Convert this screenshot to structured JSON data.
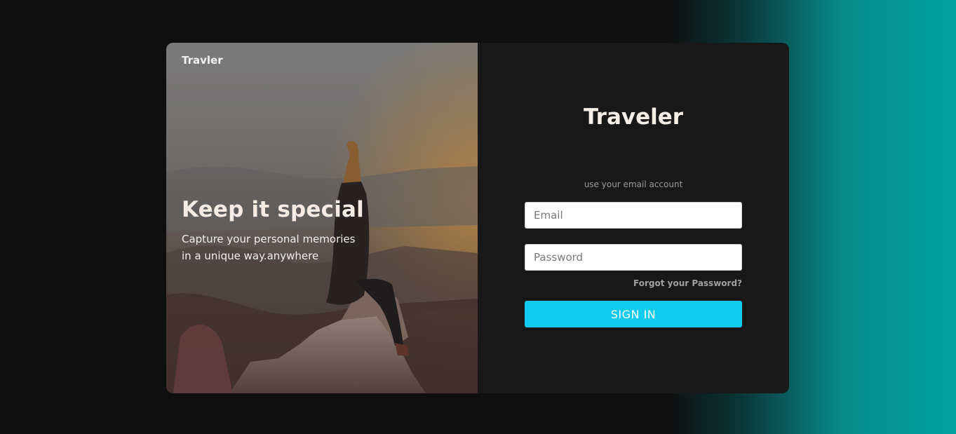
{
  "hero": {
    "brand": "Travler",
    "title": "Keep it special",
    "subtitle_line1": "Capture your personal memories",
    "subtitle_line2": "in a unique way.anywhere"
  },
  "form": {
    "title": "Traveler",
    "hint": "use your email account",
    "email_placeholder": "Email",
    "password_placeholder": "Password",
    "forgot_label": "Forgot your Password?",
    "signin_label": "SIGN IN"
  },
  "colors": {
    "accent": "#0ecbef",
    "card_bg": "#181818",
    "page_bg": "#0f0f0f",
    "gradient_edge": "#00a3a1"
  }
}
